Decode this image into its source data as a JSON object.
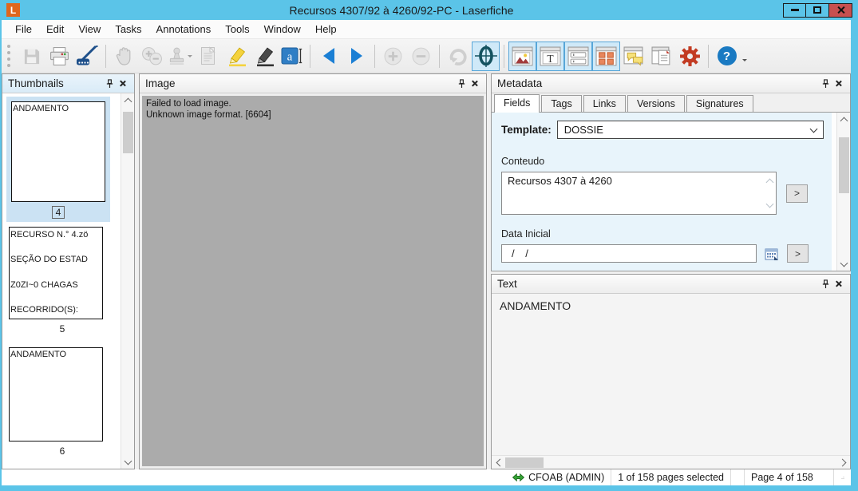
{
  "window": {
    "title": "Recursos 4307/92 à 4260/92-PC - Laserfiche",
    "logo_letter": "L"
  },
  "menu": {
    "items": [
      "File",
      "Edit",
      "View",
      "Tasks",
      "Annotations",
      "Tools",
      "Window",
      "Help"
    ]
  },
  "toolbar": {
    "icons": [
      "save-icon",
      "print-icon",
      "scan-icon",
      "pan-icon",
      "zoom-select-icon",
      "stamp-icon",
      "note-icon",
      "highlighter-icon",
      "redaction-icon",
      "text-annotation-icon",
      "previous-page-icon",
      "next-page-icon",
      "zoom-in-icon",
      "zoom-out-icon",
      "rotate-icon",
      "fit-page-icon",
      "image-pane-icon",
      "text-pane-icon",
      "fields-pane-icon",
      "thumbnails-pane-icon",
      "annotations-pane-icon",
      "document-pane-icon",
      "options-icon",
      "help-icon"
    ]
  },
  "thumbnails_panel": {
    "title": "Thumbnails",
    "items": [
      {
        "lines": [
          "ANDAMENTO"
        ],
        "page": "4",
        "selected": true
      },
      {
        "lines": [
          "RECURSO N.° 4.zö",
          "SEÇÃO DO ESTAD",
          "Z0ZI~0 CHAGAS",
          "RECORRIDO(S):"
        ],
        "page": "5",
        "selected": false
      },
      {
        "lines": [
          "ANDAMENTO"
        ],
        "page": "6",
        "selected": false
      }
    ]
  },
  "image_panel": {
    "title": "Image",
    "error_line1": "Failed to load image.",
    "error_line2": "Unknown image format. [6604]"
  },
  "metadata_panel": {
    "title": "Metadata",
    "tabs": [
      "Fields",
      "Tags",
      "Links",
      "Versions",
      "Signatures"
    ],
    "active_tab": "Fields",
    "template_label": "Template:",
    "template_value": "DOSSIE",
    "go_label": ">",
    "fields": [
      {
        "label": "Conteudo",
        "value": "Recursos 4307 à 4260"
      },
      {
        "label": "Data Inicial",
        "value": "/ /"
      }
    ]
  },
  "text_panel": {
    "title": "Text",
    "content": "ANDAMENTO"
  },
  "status_bar": {
    "user": "CFOAB (ADMIN)",
    "selection": "1 of 158 pages selected",
    "page": "Page 4 of 158"
  },
  "colors": {
    "titlebar": "#5bc4e8",
    "logo_orange": "#e0661d",
    "close_red": "#c75050",
    "toolbar_selected": "#cfe9f8",
    "toolbar_selected_border": "#58a6d8",
    "fields_bg": "#e8f4fb",
    "thumbnail_selection": "#cbe2f3",
    "image_bg": "#ababab",
    "nav_blue": "#1b7fd4",
    "gear_red": "#c23b22",
    "status_green": "#35a435"
  }
}
